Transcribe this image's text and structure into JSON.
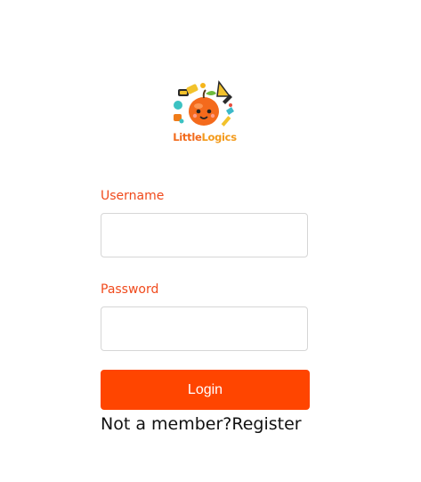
{
  "logo": {
    "icon": "apple-mascot-logo-icon",
    "text_part1": "Little",
    "text_part2": "Logics"
  },
  "form": {
    "username_label": "Username",
    "username_value": "",
    "password_label": "Password",
    "password_value": "",
    "login_label": "Login",
    "member_prompt": "Not a member?",
    "register_label": "Register"
  },
  "colors": {
    "accent": "#ff4500",
    "label": "#f04a1c",
    "input_border": "#d6d6d6"
  }
}
